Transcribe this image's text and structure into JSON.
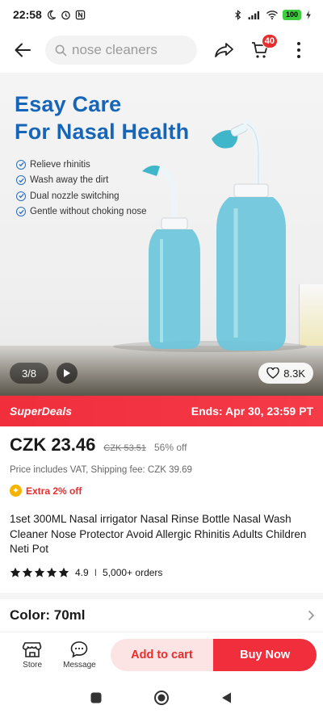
{
  "status_bar": {
    "time": "22:58",
    "left_icons": [
      "moon-icon",
      "alarm-icon",
      "nfc-icon"
    ],
    "right_icons": [
      "bluetooth-icon",
      "signal-icon",
      "wifi-icon",
      "battery-icon",
      "charging-icon"
    ],
    "battery": "100"
  },
  "topbar": {
    "search_placeholder": "nose cleaners",
    "cart_count": "40",
    "icons": [
      "back-arrow-icon",
      "search-icon",
      "share-icon",
      "cart-icon",
      "more-vertical-icon"
    ]
  },
  "hero": {
    "title_line1": "Esay Care",
    "title_line2": "For Nasal Health",
    "features": [
      "Relieve rhinitis",
      "Wash away the dirt",
      "Dual nozzle switching",
      "Gentle without choking nose"
    ],
    "image_counter": "3/8",
    "likes": "8.3K"
  },
  "deal": {
    "name": "SuperDeals",
    "ends": "Ends: Apr 30, 23:59 PT"
  },
  "price": {
    "current": "CZK 23.46",
    "original": "CZK 53.51",
    "discount": "56% off",
    "vat_note": "Price includes VAT, Shipping fee: CZK 39.69",
    "extra_off": "Extra 2% off"
  },
  "product": {
    "title": "1set 300ML Nasal irrigator Nasal Rinse Bottle Nasal Wash Cleaner Nose Protector Avoid Allergic Rhinitis Adults Children Neti Pot",
    "rating": "4.9",
    "rating_stars": 5,
    "separator": "I",
    "orders": "5,000+ orders",
    "color_label": "Color: 70ml"
  },
  "action_bar": {
    "store_label": "Store",
    "message_label": "Message",
    "add_to_cart": "Add to cart",
    "buy_now": "Buy Now"
  },
  "colors": {
    "accent_red": "#f02e3c",
    "hero_blue": "#1665b8",
    "add_cart_bg": "#fde4e4"
  }
}
